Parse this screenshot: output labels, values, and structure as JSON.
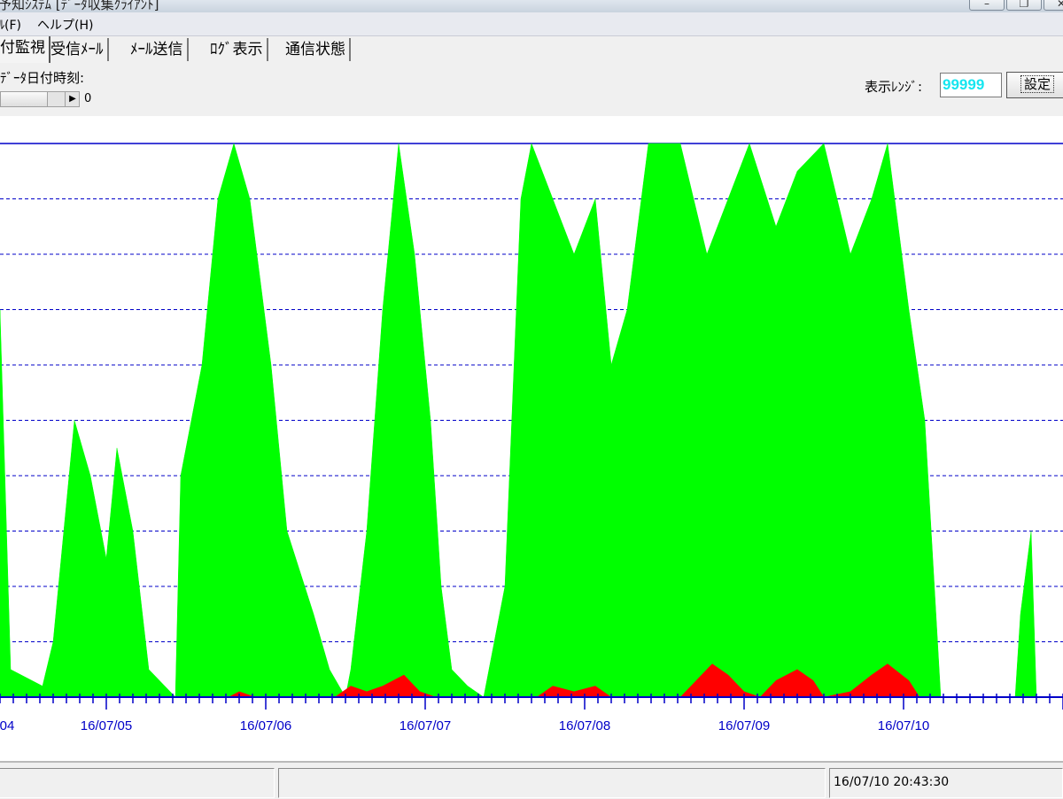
{
  "window": {
    "title": "予知ｼｽﾃﾑ [ﾃﾞｰﾀ収集ｸﾗｲｱﾝﾄ]",
    "buttons": [
      "minimize",
      "restore",
      "close"
    ]
  },
  "menu": {
    "items": [
      {
        "label": "ﾙ(F)"
      },
      {
        "label": "ヘルプ(H)"
      }
    ]
  },
  "tabs": [
    {
      "label": "付監視",
      "active": true
    },
    {
      "label": "受信ﾒｰﾙ",
      "active": false
    },
    {
      "label": "ﾒｰﾙ送信",
      "active": false
    },
    {
      "label": "ﾛｸﾞ表示",
      "active": false
    },
    {
      "label": "通信状態",
      "active": false
    }
  ],
  "toolbar": {
    "date_label": "ﾃﾞｰﾀ日付時刻:",
    "scroll_value": "0",
    "scroll_arrow": "▶",
    "range_label": "表示ﾚﾝｼﾞ:",
    "range_value": "99999",
    "set_button": "設定"
  },
  "chart_data": {
    "type": "area",
    "x_tick_labels": [
      "04",
      "16/07/05",
      "16/07/06",
      "16/07/07",
      "16/07/08",
      "16/07/09",
      "16/07/10"
    ],
    "y_max": 99999,
    "grid": "horizontal dashed, 10 divisions",
    "series": [
      {
        "color": "#00ff00",
        "points": [
          [
            0.0,
            0.7
          ],
          [
            0.1,
            0.05
          ],
          [
            0.4,
            0.02
          ],
          [
            0.5,
            0.1
          ],
          [
            0.7,
            0.5
          ],
          [
            0.85,
            0.4
          ],
          [
            1.0,
            0.25
          ],
          [
            1.1,
            0.45
          ],
          [
            1.25,
            0.3
          ],
          [
            1.4,
            0.05
          ],
          [
            1.55,
            0.02
          ],
          [
            1.65,
            0.0
          ],
          [
            1.7,
            0.4
          ],
          [
            1.9,
            0.6
          ],
          [
            2.05,
            0.9
          ],
          [
            2.2,
            1.0
          ],
          [
            2.35,
            0.9
          ],
          [
            2.55,
            0.6
          ],
          [
            2.7,
            0.3
          ],
          [
            2.95,
            0.15
          ],
          [
            3.1,
            0.05
          ],
          [
            3.25,
            0.0
          ],
          [
            3.3,
            0.05
          ],
          [
            3.45,
            0.3
          ],
          [
            3.6,
            0.7
          ],
          [
            3.75,
            1.0
          ],
          [
            3.9,
            0.8
          ],
          [
            4.05,
            0.5
          ],
          [
            4.15,
            0.2
          ],
          [
            4.25,
            0.05
          ],
          [
            4.4,
            0.02
          ],
          [
            4.55,
            0.0
          ],
          [
            4.75,
            0.2
          ],
          [
            4.9,
            0.9
          ],
          [
            5.0,
            1.0
          ],
          [
            5.2,
            0.9
          ],
          [
            5.4,
            0.8
          ],
          [
            5.6,
            0.9
          ],
          [
            5.75,
            0.6
          ],
          [
            5.9,
            0.7
          ],
          [
            6.1,
            1.0
          ],
          [
            6.4,
            1.0
          ],
          [
            6.65,
            0.8
          ],
          [
            6.85,
            0.9
          ],
          [
            7.05,
            1.0
          ],
          [
            7.3,
            0.85
          ],
          [
            7.5,
            0.95
          ],
          [
            7.75,
            1.0
          ],
          [
            8.0,
            0.8
          ],
          [
            8.2,
            0.9
          ],
          [
            8.35,
            1.0
          ],
          [
            8.55,
            0.7
          ],
          [
            8.7,
            0.5
          ],
          [
            8.85,
            0.0
          ],
          [
            9.55,
            0.0
          ],
          [
            9.6,
            0.15
          ],
          [
            9.7,
            0.3
          ],
          [
            9.75,
            0.0
          ],
          [
            10.0,
            0.0
          ]
        ]
      },
      {
        "color": "#ff0000",
        "points": [
          [
            0.0,
            0.0
          ],
          [
            2.15,
            0.0
          ],
          [
            2.25,
            0.01
          ],
          [
            2.4,
            0.0
          ],
          [
            3.15,
            0.0
          ],
          [
            3.3,
            0.02
          ],
          [
            3.45,
            0.01
          ],
          [
            3.6,
            0.02
          ],
          [
            3.8,
            0.04
          ],
          [
            3.95,
            0.01
          ],
          [
            4.1,
            0.0
          ],
          [
            5.05,
            0.0
          ],
          [
            5.2,
            0.02
          ],
          [
            5.4,
            0.01
          ],
          [
            5.6,
            0.02
          ],
          [
            5.75,
            0.0
          ],
          [
            6.4,
            0.0
          ],
          [
            6.55,
            0.03
          ],
          [
            6.7,
            0.06
          ],
          [
            6.85,
            0.04
          ],
          [
            7.0,
            0.01
          ],
          [
            7.15,
            0.0
          ],
          [
            7.3,
            0.03
          ],
          [
            7.5,
            0.05
          ],
          [
            7.65,
            0.03
          ],
          [
            7.75,
            0.0
          ],
          [
            8.0,
            0.01
          ],
          [
            8.2,
            0.04
          ],
          [
            8.35,
            0.06
          ],
          [
            8.55,
            0.03
          ],
          [
            8.65,
            0.0
          ],
          [
            10.0,
            0.0
          ]
        ]
      }
    ]
  },
  "status": {
    "pane1": "",
    "pane2": "",
    "datetime": "16/07/10 20:43:30"
  },
  "colors": {
    "grid": "#0000c8",
    "axis": "#0000c8",
    "primary": "#00ff00",
    "secondary": "#ff0000",
    "range_text": "#17e6f0"
  }
}
